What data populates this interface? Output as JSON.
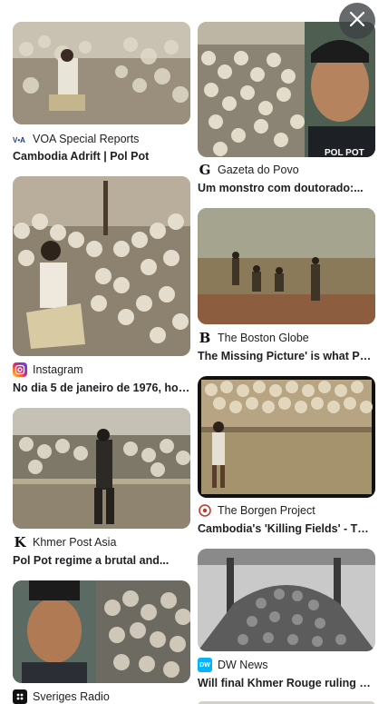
{
  "results": [
    {
      "source": "VOA Special Reports",
      "title": "Cambodia Adrift | Pol Pot",
      "favicon": "voa-logo-icon"
    },
    {
      "source": "Instagram",
      "title": "No dia 5 de janeiro de 1976, hoj...",
      "favicon": "instagram-icon"
    },
    {
      "source": "Khmer Post Asia",
      "title": "Pol Pot regime a brutal and...",
      "favicon": "khmer-post-logo-icon"
    },
    {
      "source": "Sveriges Radio",
      "title": "",
      "favicon": "sveriges-radio-icon"
    },
    {
      "source": "Gazeta do Povo",
      "title": "Um monstro com doutorado:...",
      "favicon": "gazeta-logo-icon"
    },
    {
      "source": "The Boston Globe",
      "title": "The Missing Picture' is what Pol...",
      "favicon": "boston-globe-icon"
    },
    {
      "source": "The Borgen Project",
      "title": "Cambodia's 'Killing Fields' - The...",
      "favicon": "borgen-project-icon"
    },
    {
      "source": "DW News",
      "title": "Will final Khmer Rouge ruling en...",
      "favicon": "dw-news-icon"
    }
  ],
  "image_caption_pol_pot": "POL POT",
  "favicon_letters": {
    "gazeta": "G",
    "boston": "B",
    "khmer": "K",
    "dw": "DW"
  },
  "colors": {
    "instagram": "#d6249f",
    "dw": "#05b2fc",
    "borgen": "#c0392b"
  },
  "close_icon": "close-icon"
}
